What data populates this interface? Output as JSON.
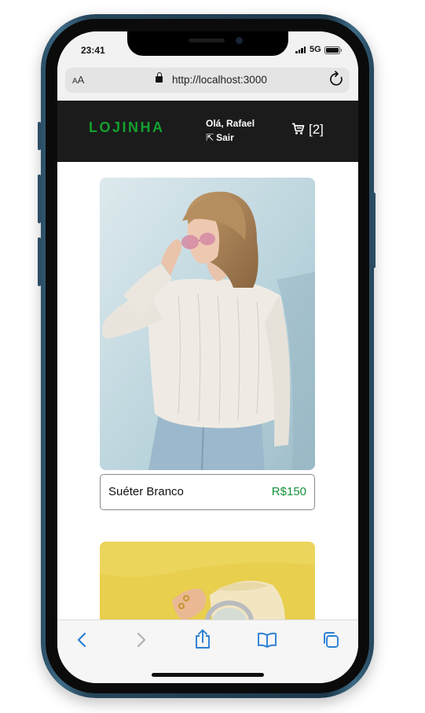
{
  "status_bar": {
    "time": "23:41",
    "network": "5G"
  },
  "browser": {
    "text_size_label": "A",
    "text_size_label_small": "A",
    "url": "http://localhost:3000"
  },
  "header": {
    "logo": "LOJINHA",
    "greeting": "Olá, Rafael",
    "logout_icon": "⇱",
    "logout_label": "Sair",
    "cart_count": "[2]"
  },
  "products": [
    {
      "name": "Suéter Branco",
      "price": "R$150"
    }
  ],
  "colors": {
    "logo_green": "#14a12f",
    "price_green": "#17913a",
    "header_bg": "#1b1b1b",
    "toolbar_blue": "#2b7fd4"
  },
  "icons": {
    "back": "chevron-left-icon",
    "forward": "chevron-right-icon",
    "share": "share-icon",
    "bookmarks": "book-icon",
    "tabs": "tabs-icon",
    "cart": "cart-icon",
    "lock": "lock-icon",
    "reload": "reload-icon",
    "logout": "logout-icon"
  }
}
